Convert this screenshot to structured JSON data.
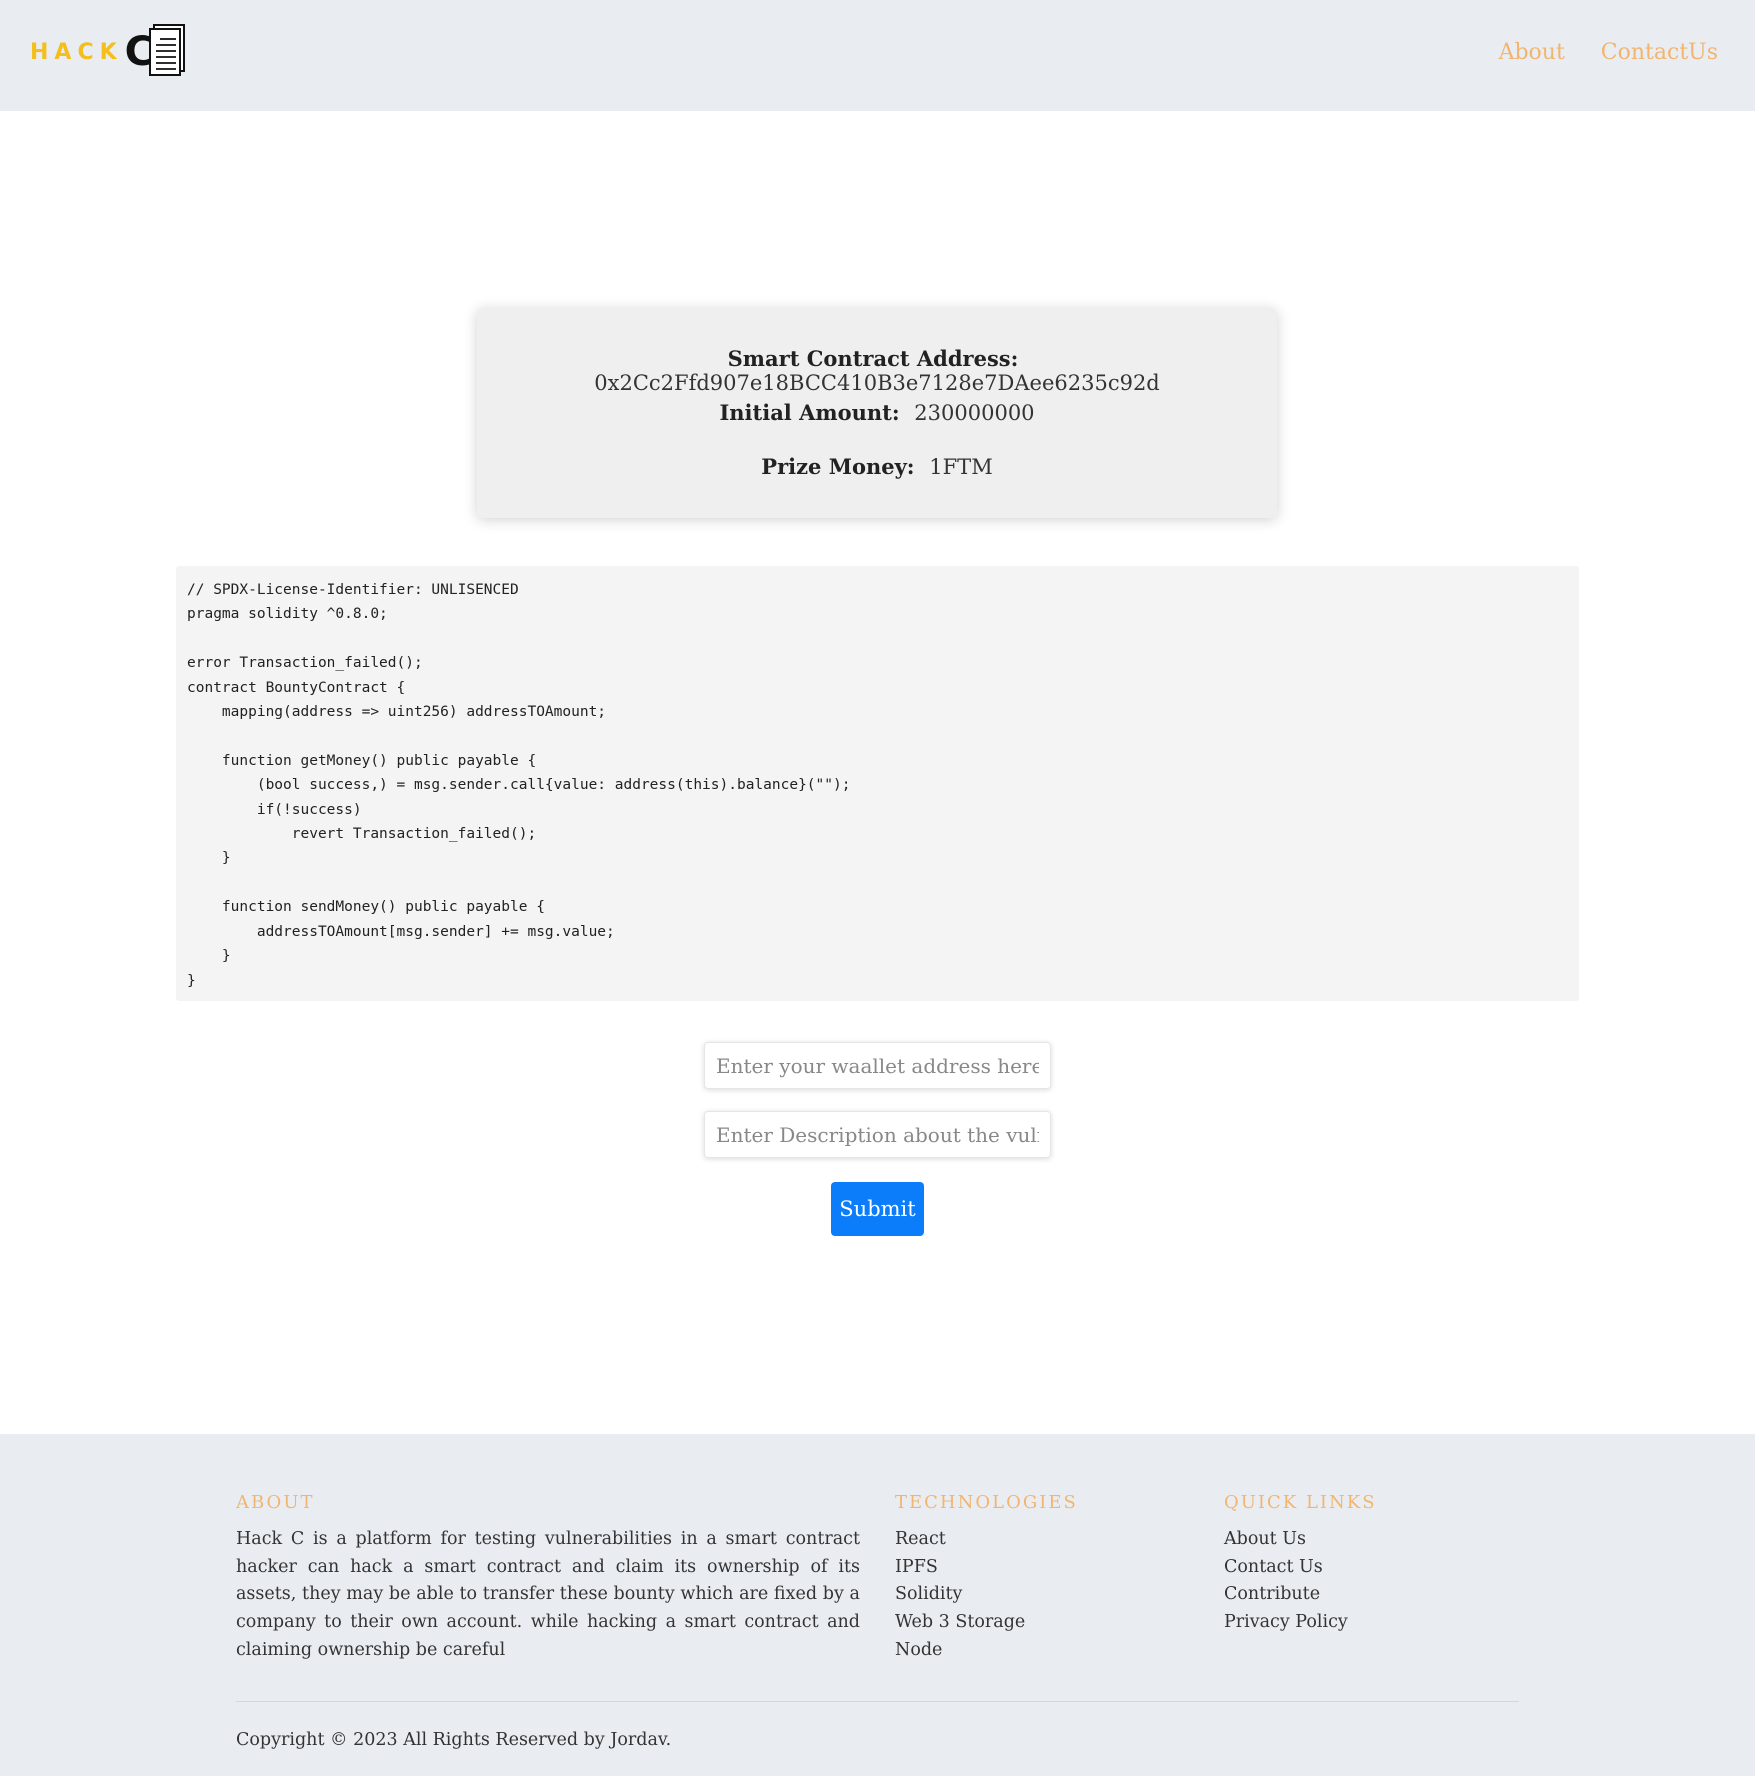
{
  "header": {
    "logo_text": "HACK",
    "logo_letter": "C",
    "nav": [
      {
        "label": "About"
      },
      {
        "label": "ContactUs"
      }
    ]
  },
  "contract_info": {
    "address_label": "Smart Contract Address:",
    "address_value": "0x2Cc2Ffd907e18BCC410B3e7128e7DAee6235c92d",
    "amount_label": "Initial Amount:",
    "amount_value": "230000000",
    "prize_label": "Prize Money:",
    "prize_value": "1FTM"
  },
  "code": "// SPDX-License-Identifier: UNLISENCED\npragma solidity ^0.8.0;\n\nerror Transaction_failed();\ncontract BountyContract {\n    mapping(address => uint256) addressTOAmount;\n\n    function getMoney() public payable {\n        (bool success,) = msg.sender.call{value: address(this).balance}(\"\");\n        if(!success)\n            revert Transaction_failed();\n    }\n\n    function sendMoney() public payable {\n        addressTOAmount[msg.sender] += msg.value;\n    }\n}",
  "form": {
    "wallet_placeholder": "Enter your waallet address here",
    "description_placeholder": "Enter Description about the vuln",
    "submit_label": "Submit"
  },
  "footer": {
    "about_heading": "ABOUT",
    "about_text": "Hack C is a platform for testing vulnerabilities in a smart contract hacker can hack a smart contract and claim its ownership of its assets, they may be able to transfer these bounty which are fixed by a company to their own account. while hacking a smart contract and claiming ownership be careful",
    "tech_heading": "TECHNOLOGIES",
    "tech_items": [
      "React",
      "IPFS",
      "Solidity",
      "Web 3 Storage",
      "Node"
    ],
    "links_heading": "QUICK LINKS",
    "link_items": [
      "About Us",
      "Contact Us",
      "Contribute",
      "Privacy Policy"
    ],
    "copyright": "Copyright © 2023 All Rights Reserved by Jordav."
  }
}
